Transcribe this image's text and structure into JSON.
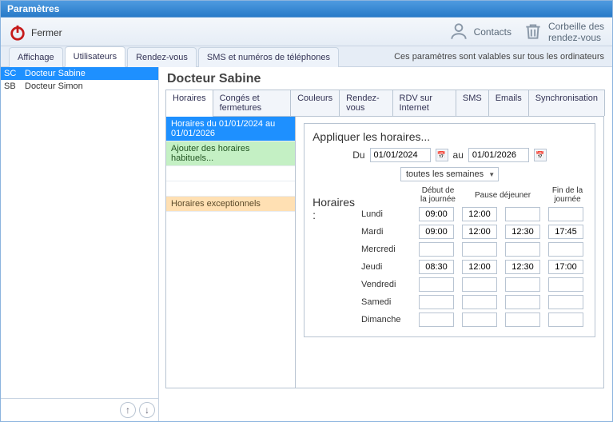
{
  "window": {
    "title": "Paramètres"
  },
  "toolbar": {
    "close_label": "Fermer",
    "contacts_label": "Contacts",
    "trash_label": "Corbeille des\nrendez-vous"
  },
  "main_tabs": {
    "items": [
      {
        "label": "Affichage"
      },
      {
        "label": "Utilisateurs"
      },
      {
        "label": "Rendez-vous"
      },
      {
        "label": "SMS et numéros de téléphones"
      }
    ],
    "footnote": "Ces paramètres sont valables sur tous les ordinateurs"
  },
  "users": [
    {
      "code": "SC",
      "name": "Docteur Sabine",
      "selected": true
    },
    {
      "code": "SB",
      "name": "Docteur Simon",
      "selected": false
    }
  ],
  "detail": {
    "title": "Docteur Sabine",
    "sub_tabs": [
      {
        "label": "Horaires"
      },
      {
        "label": "Congés et fermetures"
      },
      {
        "label": "Couleurs"
      },
      {
        "label": "Rendez-vous"
      },
      {
        "label": "RDV sur Internet"
      },
      {
        "label": "SMS"
      },
      {
        "label": "Emails"
      },
      {
        "label": "Synchronisation"
      }
    ],
    "tree": {
      "item_selected": "Horaires du 01/01/2024 au 01/01/2026",
      "add_label": "Ajouter des horaires habituels...",
      "exceptional_label": "Horaires exceptionnels"
    },
    "apply": {
      "title": "Appliquer les horaires...",
      "du_label": "Du",
      "date_from": "01/01/2024",
      "au_label": "au",
      "date_to": "01/01/2026",
      "recurrence": "toutes les semaines"
    },
    "hours": {
      "section_label": "Horaires :",
      "headers": {
        "start": "Début de\nla journée",
        "pause": "Pause\ndéjeuner",
        "end": "Fin de\nla journée"
      },
      "days": [
        {
          "label": "Lundi",
          "start": "09:00",
          "p1": "12:00",
          "p2": "",
          "end": ""
        },
        {
          "label": "Mardi",
          "start": "09:00",
          "p1": "12:00",
          "p2": "12:30",
          "end": "17:45"
        },
        {
          "label": "Mercredi",
          "start": "",
          "p1": "",
          "p2": "",
          "end": ""
        },
        {
          "label": "Jeudi",
          "start": "08:30",
          "p1": "12:00",
          "p2": "12:30",
          "end": "17:00"
        },
        {
          "label": "Vendredi",
          "start": "",
          "p1": "",
          "p2": "",
          "end": ""
        },
        {
          "label": "Samedi",
          "start": "",
          "p1": "",
          "p2": "",
          "end": ""
        },
        {
          "label": "Dimanche",
          "start": "",
          "p1": "",
          "p2": "",
          "end": ""
        }
      ]
    }
  }
}
